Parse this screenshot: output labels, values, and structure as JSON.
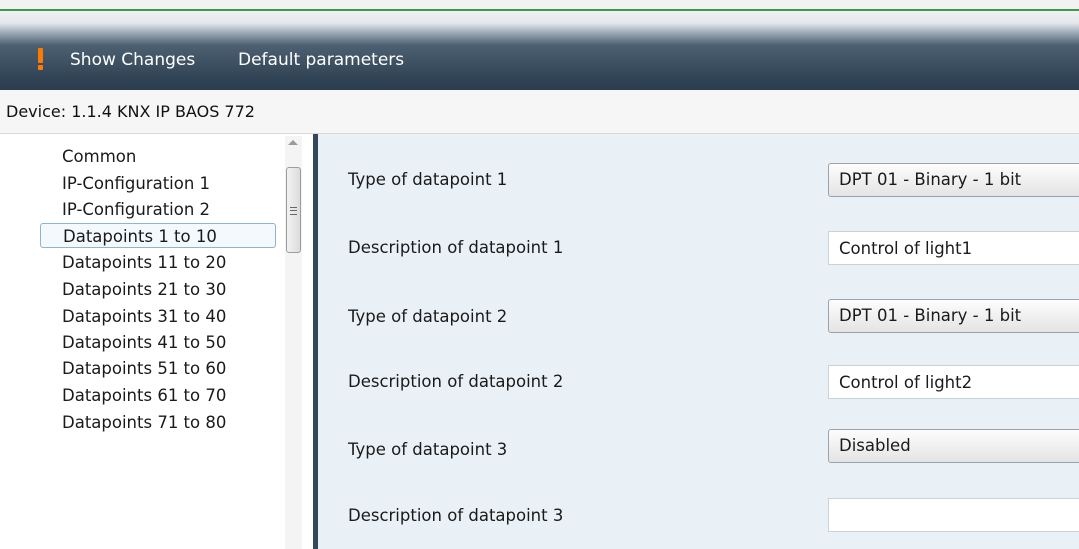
{
  "toolbar": {
    "show_changes": "Show Changes",
    "default_parameters": "Default parameters"
  },
  "device": {
    "line": "Device: 1.1.4  KNX IP BAOS 772"
  },
  "nav": {
    "items": [
      "Common",
      "IP-Configuration 1",
      "IP-Configuration 2",
      "Datapoints 1 to 10",
      "Datapoints 11 to 20",
      "Datapoints 21 to 30",
      "Datapoints 31 to 40",
      "Datapoints 41 to 50",
      "Datapoints 51 to 60",
      "Datapoints 61 to 70",
      "Datapoints 71 to 80"
    ],
    "selected": "Datapoints 1 to 10"
  },
  "params": {
    "type1_label": "Type of datapoint 1",
    "type1_value": "DPT 01 - Binary - 1 bit",
    "desc1_label": "Description of datapoint 1",
    "desc1_value": "Control of light1",
    "type2_label": "Type of datapoint 2",
    "type2_value": "DPT 01 - Binary - 1 bit",
    "desc2_label": "Description of datapoint 2",
    "desc2_value": "Control of light2",
    "type3_label": "Type of datapoint 3",
    "type3_value": "Disabled",
    "desc3_label": "Description of datapoint 3",
    "desc3_value": ""
  },
  "colors": {
    "toolbar_dark": "#2f4254",
    "accent_green": "#3b9a4a",
    "warning_orange": "#ff7a00",
    "panel_bg": "#e9f1f7"
  }
}
